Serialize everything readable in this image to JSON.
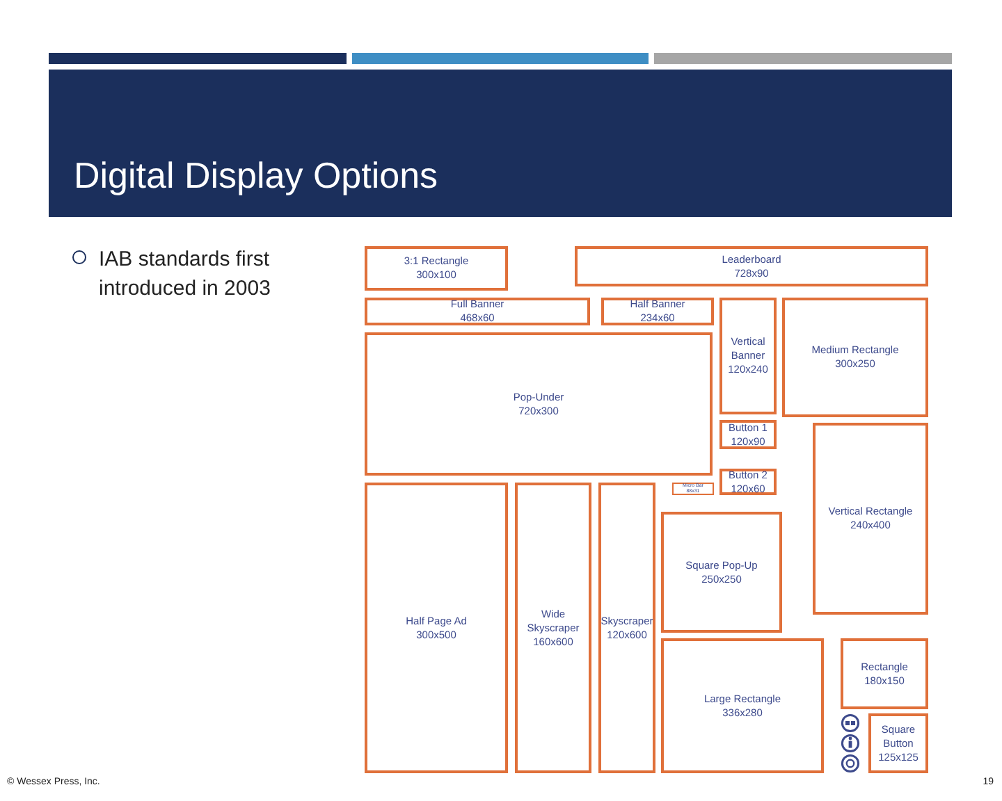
{
  "title": "Digital Display Options",
  "bullets": [
    "IAB standards first introduced in 2003"
  ],
  "ad_sizes": [
    {
      "name": "3:1 Rectangle",
      "size": "300x100"
    },
    {
      "name": "Leaderboard",
      "size": "728x90"
    },
    {
      "name": "Full Banner",
      "size": "468x60"
    },
    {
      "name": "Half Banner",
      "size": "234x60"
    },
    {
      "name": "Vertical Banner",
      "size": "120x240"
    },
    {
      "name": "Medium Rectangle",
      "size": "300x250"
    },
    {
      "name": "Pop-Under",
      "size": "720x300"
    },
    {
      "name": "Button 1",
      "size": "120x90"
    },
    {
      "name": "Micro Bar",
      "size": "88x31"
    },
    {
      "name": "Button 2",
      "size": "120x60"
    },
    {
      "name": "Vertical Rectangle",
      "size": "240x400"
    },
    {
      "name": "Half Page Ad",
      "size": "300x500"
    },
    {
      "name": "Wide Skyscraper",
      "size": "160x600"
    },
    {
      "name": "Skyscraper",
      "size": "120x600"
    },
    {
      "name": "Square Pop-Up",
      "size": "250x250"
    },
    {
      "name": "Large Rectangle",
      "size": "336x280"
    },
    {
      "name": "Rectangle",
      "size": "180x150"
    },
    {
      "name": "Square Button",
      "size": "125x125"
    }
  ],
  "footer": "© Wessex Press, Inc.",
  "page_number": "19"
}
